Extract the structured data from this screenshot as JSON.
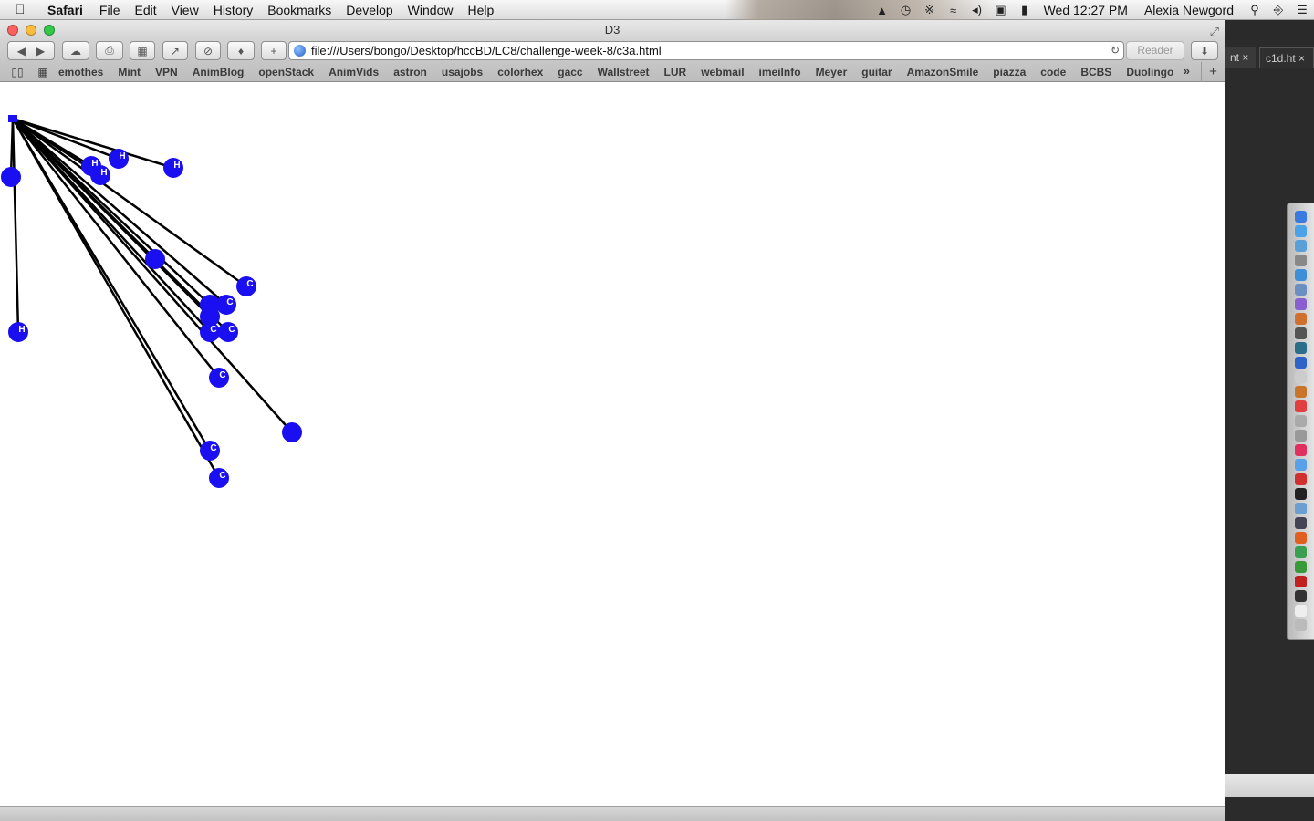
{
  "menubar": {
    "app_name": "Safari",
    "menus": [
      "File",
      "Edit",
      "View",
      "History",
      "Bookmarks",
      "Develop",
      "Window",
      "Help"
    ],
    "clock": "Wed 12:27 PM",
    "user": "Alexia Newgord"
  },
  "window": {
    "title": "D3",
    "url": "file:///Users/bongo/Desktop/hccBD/LC8/challenge-week-8/c3a.html",
    "reader_label": "Reader",
    "bookmarks": [
      "emothes",
      "Mint",
      "VPN",
      "AnimBlog",
      "openStack",
      "AnimVids",
      "astron",
      "usajobs",
      "colorhex",
      "gacc",
      "Wallstreet",
      "LUR",
      "webmail",
      "imeiInfo",
      "Meyer",
      "guitar",
      "AmazonSmile",
      "piazza",
      "code",
      "BCBS",
      "Duolingo"
    ]
  },
  "background_window": {
    "tabs": [
      "nt",
      "c1d.ht"
    ]
  },
  "graph": {
    "node_color": "#1a0ff0",
    "nodes": [
      {
        "label": "H"
      },
      {
        "label": "H"
      },
      {
        "label": "H"
      },
      {
        "label": "H"
      },
      {
        "label": ""
      },
      {
        "label": "H"
      },
      {
        "label": ""
      },
      {
        "label": "C"
      },
      {
        "label": "C"
      },
      {
        "label": ""
      },
      {
        "label": ""
      },
      {
        "label": "C"
      },
      {
        "label": "C"
      },
      {
        "label": "C"
      },
      {
        "label": ""
      },
      {
        "label": "C"
      },
      {
        "label": "C"
      }
    ]
  }
}
